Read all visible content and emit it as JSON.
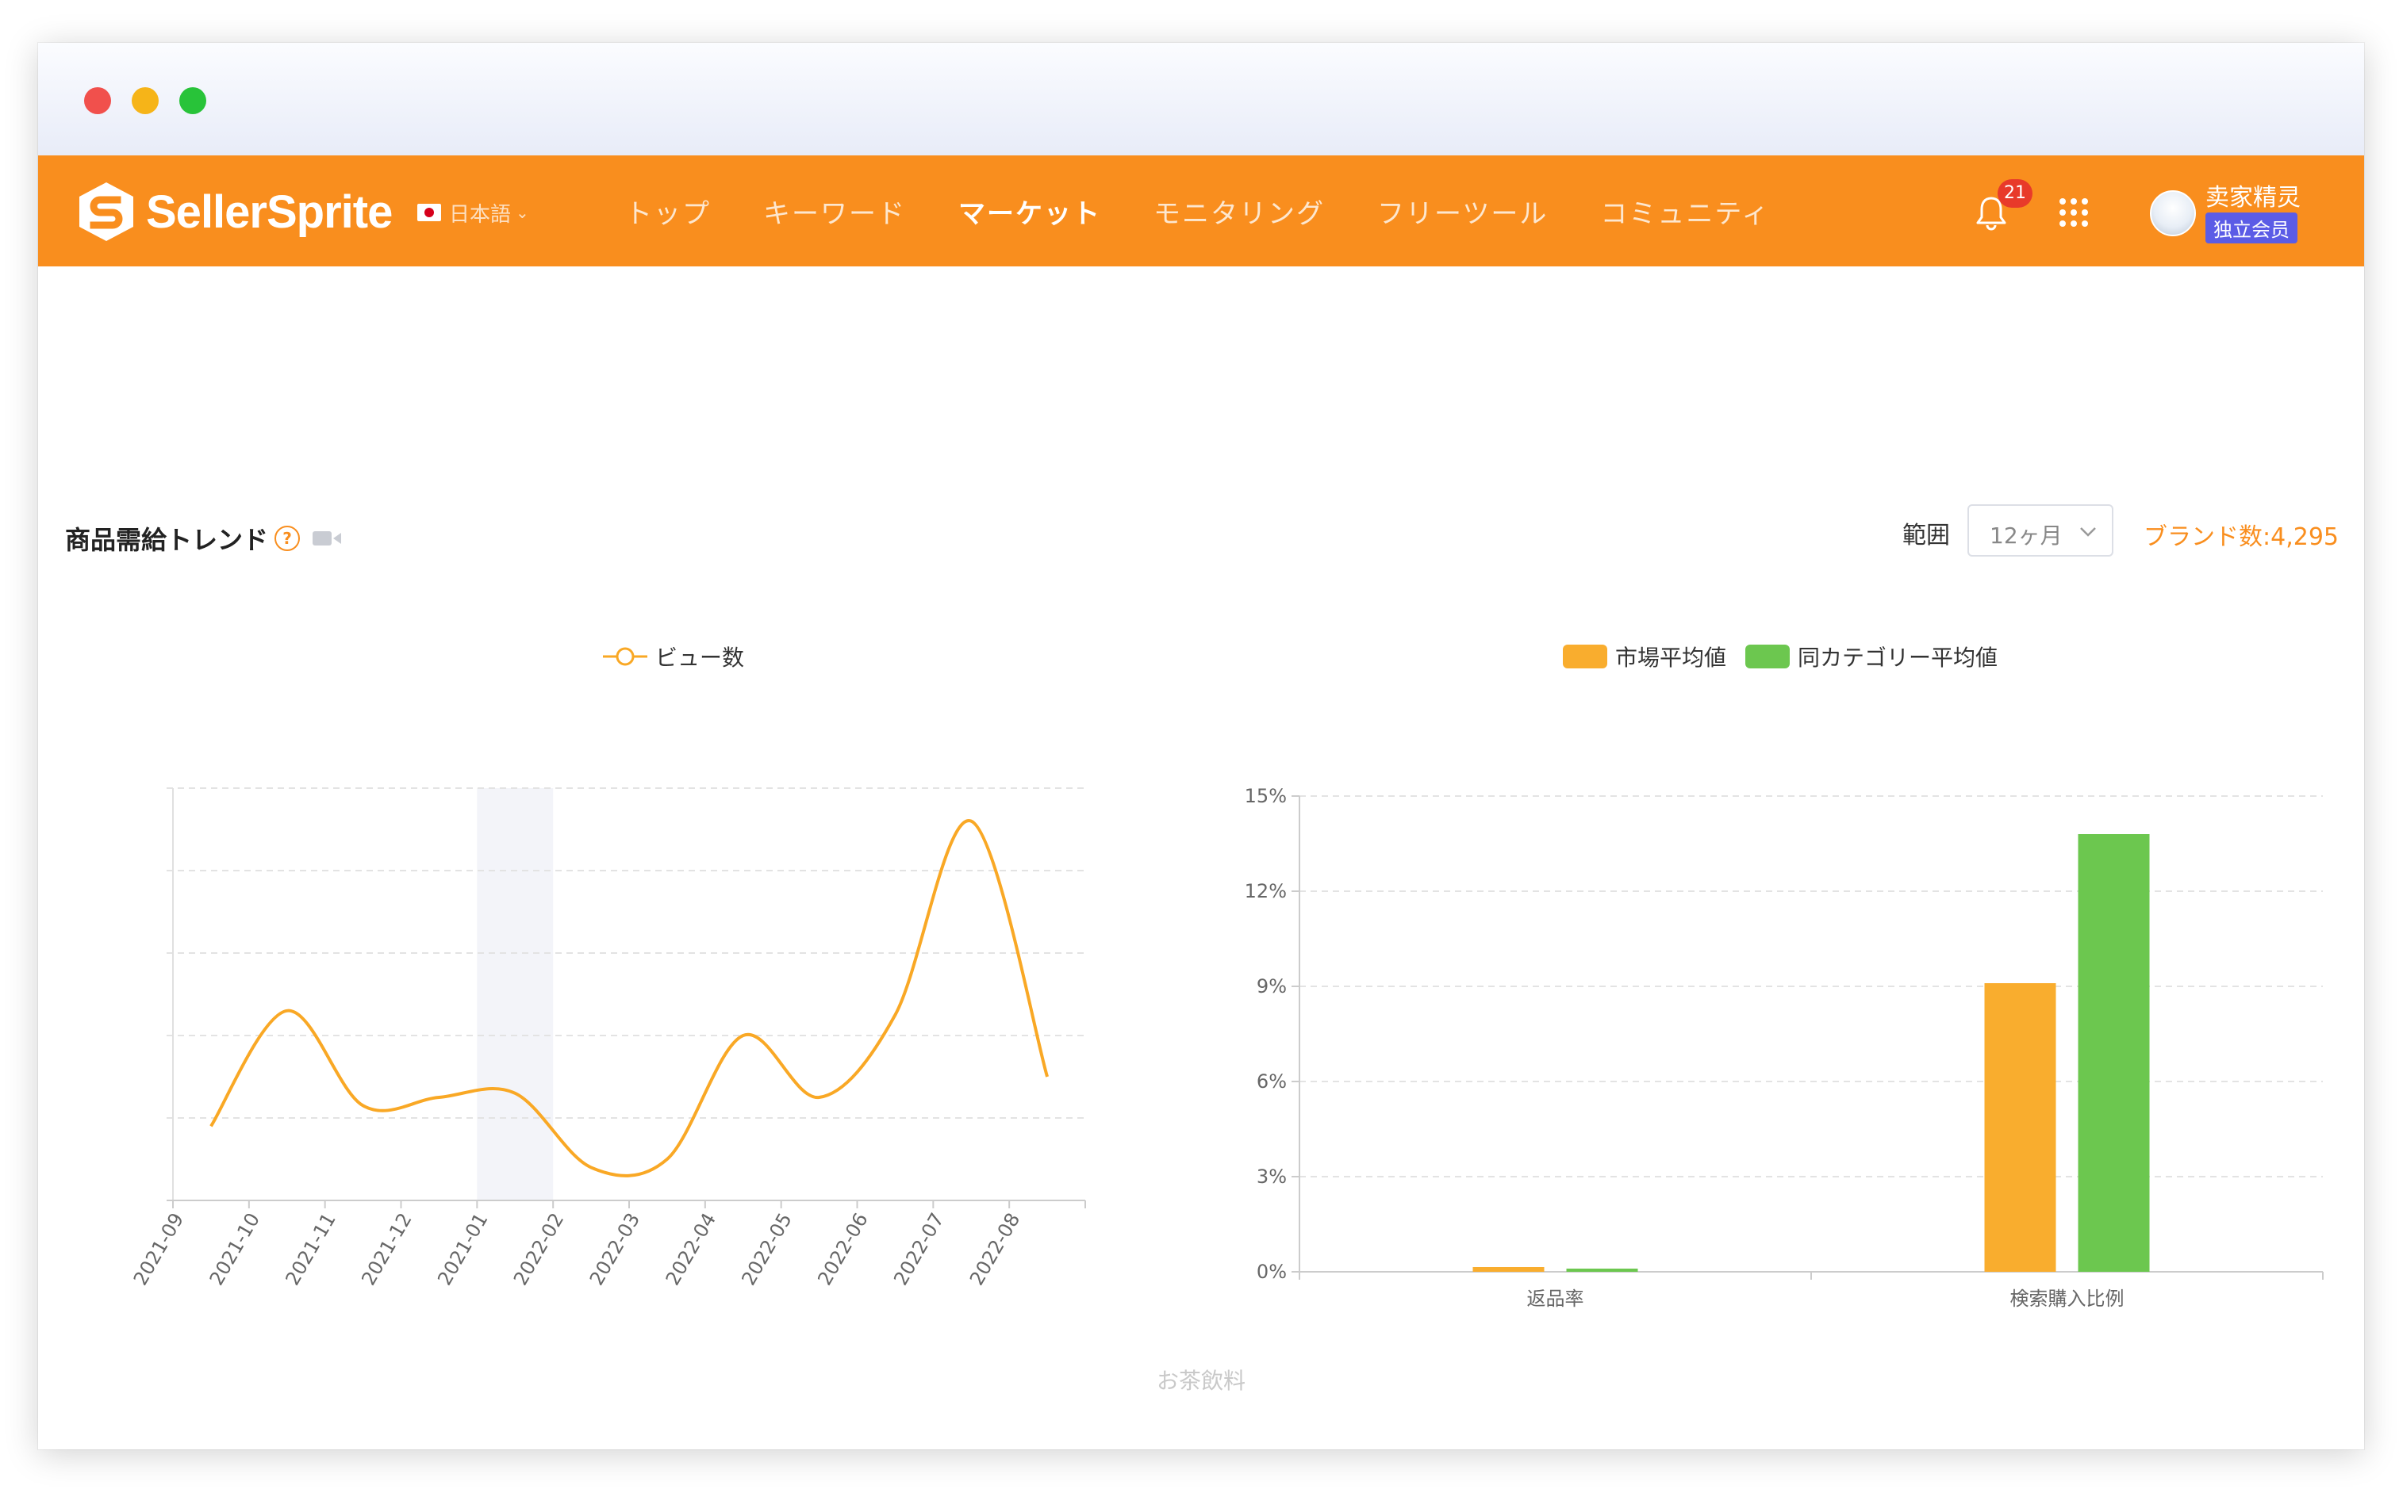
{
  "window": {
    "controls": [
      "close",
      "minimize",
      "maximize"
    ]
  },
  "navbar": {
    "brand": "SellerSprite",
    "language": "日本語",
    "items": [
      {
        "label": "トップ",
        "active": false
      },
      {
        "label": "キーワード",
        "active": false
      },
      {
        "label": "マーケット",
        "active": true
      },
      {
        "label": "モニタリング",
        "active": false
      },
      {
        "label": "フリーツール",
        "active": false
      },
      {
        "label": "コミュニティ",
        "active": false
      }
    ],
    "notifications": "21",
    "user": {
      "name": "卖家精灵",
      "membership": "独立会员"
    },
    "accent": "#f98e1e"
  },
  "section": {
    "title": "商品需給トレンド",
    "help_icon": "?",
    "range_label": "範囲",
    "range_value": "12ヶ月",
    "brand_count": "ブランド数:4,295"
  },
  "footer_note": "お茶飲料",
  "chart_data": [
    {
      "type": "line",
      "legend": [
        "ビュー数"
      ],
      "x": [
        "2021-09",
        "2021-10",
        "2021-11",
        "2021-12",
        "2021-01",
        "2022-02",
        "2022-03",
        "2022-04",
        "2022-05",
        "2022-06",
        "2022-07",
        "2022-08"
      ],
      "series": [
        {
          "name": "ビュー数",
          "values": [
            18,
            46,
            23,
            25,
            26,
            8,
            10,
            40,
            25,
            45,
            92,
            30
          ],
          "color": "#f9a825"
        }
      ],
      "ylim": [
        0,
        100
      ],
      "highlight_category": "2021-01",
      "grid": true,
      "y_tick_labels_shown": false
    },
    {
      "type": "bar",
      "legend": [
        "市場平均値",
        "同カテゴリー平均値"
      ],
      "categories": [
        "返品率",
        "検索購入比例"
      ],
      "series": [
        {
          "name": "市場平均値",
          "values": [
            0.15,
            9.1
          ],
          "color": "#f9ad2e"
        },
        {
          "name": "同カテゴリー平均値",
          "values": [
            0.1,
            13.8
          ],
          "color": "#6cc74f"
        }
      ],
      "yticks": [
        "0%",
        "3%",
        "6%",
        "9%",
        "12%",
        "15%"
      ],
      "ylim": [
        0,
        15
      ],
      "grid": true
    }
  ]
}
